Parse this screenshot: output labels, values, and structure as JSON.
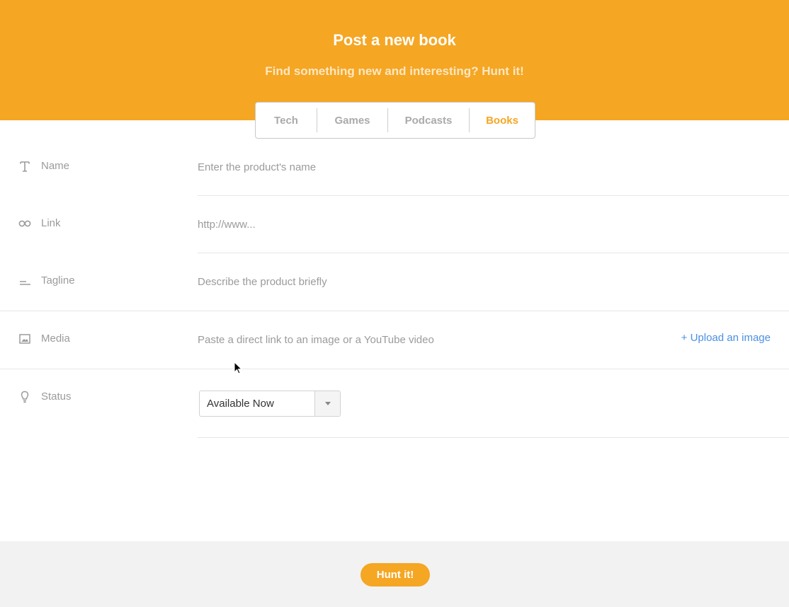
{
  "header": {
    "title": "Post a new book",
    "subtitle": "Find something new and interesting? Hunt it!"
  },
  "tabs": [
    {
      "label": "Tech",
      "active": false
    },
    {
      "label": "Games",
      "active": false
    },
    {
      "label": "Podcasts",
      "active": false
    },
    {
      "label": "Books",
      "active": true
    }
  ],
  "form": {
    "name": {
      "label": "Name",
      "value": "",
      "placeholder": "Enter the product's name",
      "icon": "text-icon"
    },
    "link": {
      "label": "Link",
      "value": "",
      "placeholder": "http://www...",
      "icon": "link-icon"
    },
    "tagline": {
      "label": "Tagline",
      "value": "",
      "placeholder": "Describe the product briefly",
      "icon": "tagline-icon"
    },
    "media": {
      "label": "Media",
      "value": "",
      "placeholder": "Paste a direct link to an image or a YouTube video",
      "icon": "image-icon",
      "upload_label": "+ Upload an image"
    },
    "status": {
      "label": "Status",
      "selected": "Available Now",
      "icon": "lightbulb-icon"
    }
  },
  "footer": {
    "submit_label": "Hunt it!"
  },
  "colors": {
    "accent": "#f5a623",
    "link": "#4a90e2",
    "muted": "#9b9b9b"
  }
}
